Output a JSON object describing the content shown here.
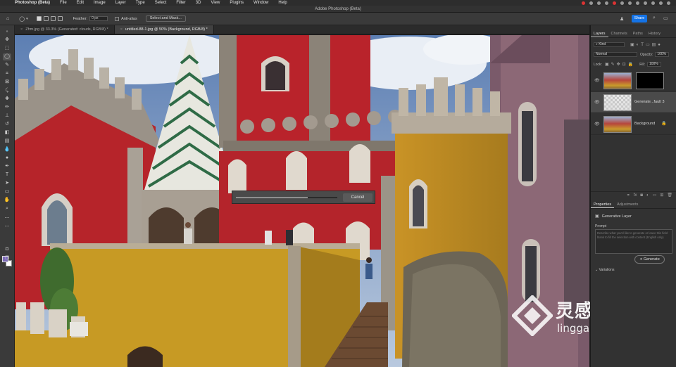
{
  "menubar": {
    "app_name": "Photoshop (Beta)",
    "items": [
      "File",
      "Edit",
      "Image",
      "Layer",
      "Type",
      "Select",
      "Filter",
      "3D",
      "View",
      "Plugins",
      "Window",
      "Help"
    ]
  },
  "window": {
    "title": "Adobe Photoshop (Beta)"
  },
  "options": {
    "feather_label": "Feather:",
    "feather_value": "0 px",
    "antialias_label": "Anti-alias",
    "select_mask_label": "Select and Mask...",
    "share_label": "Share"
  },
  "tabs": [
    {
      "label": "Zhm.jpg @ 33.3% (Generated: clouds, RGB/8) *"
    },
    {
      "label": "untitled-88-1.jpg @ 50% (Background, RGB/8) *"
    }
  ],
  "progress": {
    "value": 0.71,
    "cancel_label": "Cancel"
  },
  "layers_panel": {
    "tabs": [
      "Layers",
      "Channels",
      "Paths",
      "History"
    ],
    "kind_label": "Kind",
    "blend_mode": "Normal",
    "opacity_label": "Opacity:",
    "opacity_value": "100%",
    "lock_label": "Lock:",
    "fill_label": "Fill:",
    "fill_value": "100%",
    "layers": [
      {
        "name": ""
      },
      {
        "name": "Generate...fault 3"
      },
      {
        "name": "Background"
      }
    ]
  },
  "properties_panel": {
    "tabs": [
      "Properties",
      "Adjustments"
    ],
    "title": "Generative Layer",
    "prompt_label": "Prompt",
    "prompt_placeholder": "Describe what you'd like to generate or leave this field blank to fill the selection with content (English only)",
    "generate_label": "Generate",
    "variations_label": "Variations"
  },
  "watermark": {
    "cn": "灵感中国",
    "en": "lingganchina.com"
  },
  "colors": {
    "accent": "#1473e6",
    "fg_swatch": "#7c6ab8",
    "bg_swatch": "#ffffff"
  }
}
